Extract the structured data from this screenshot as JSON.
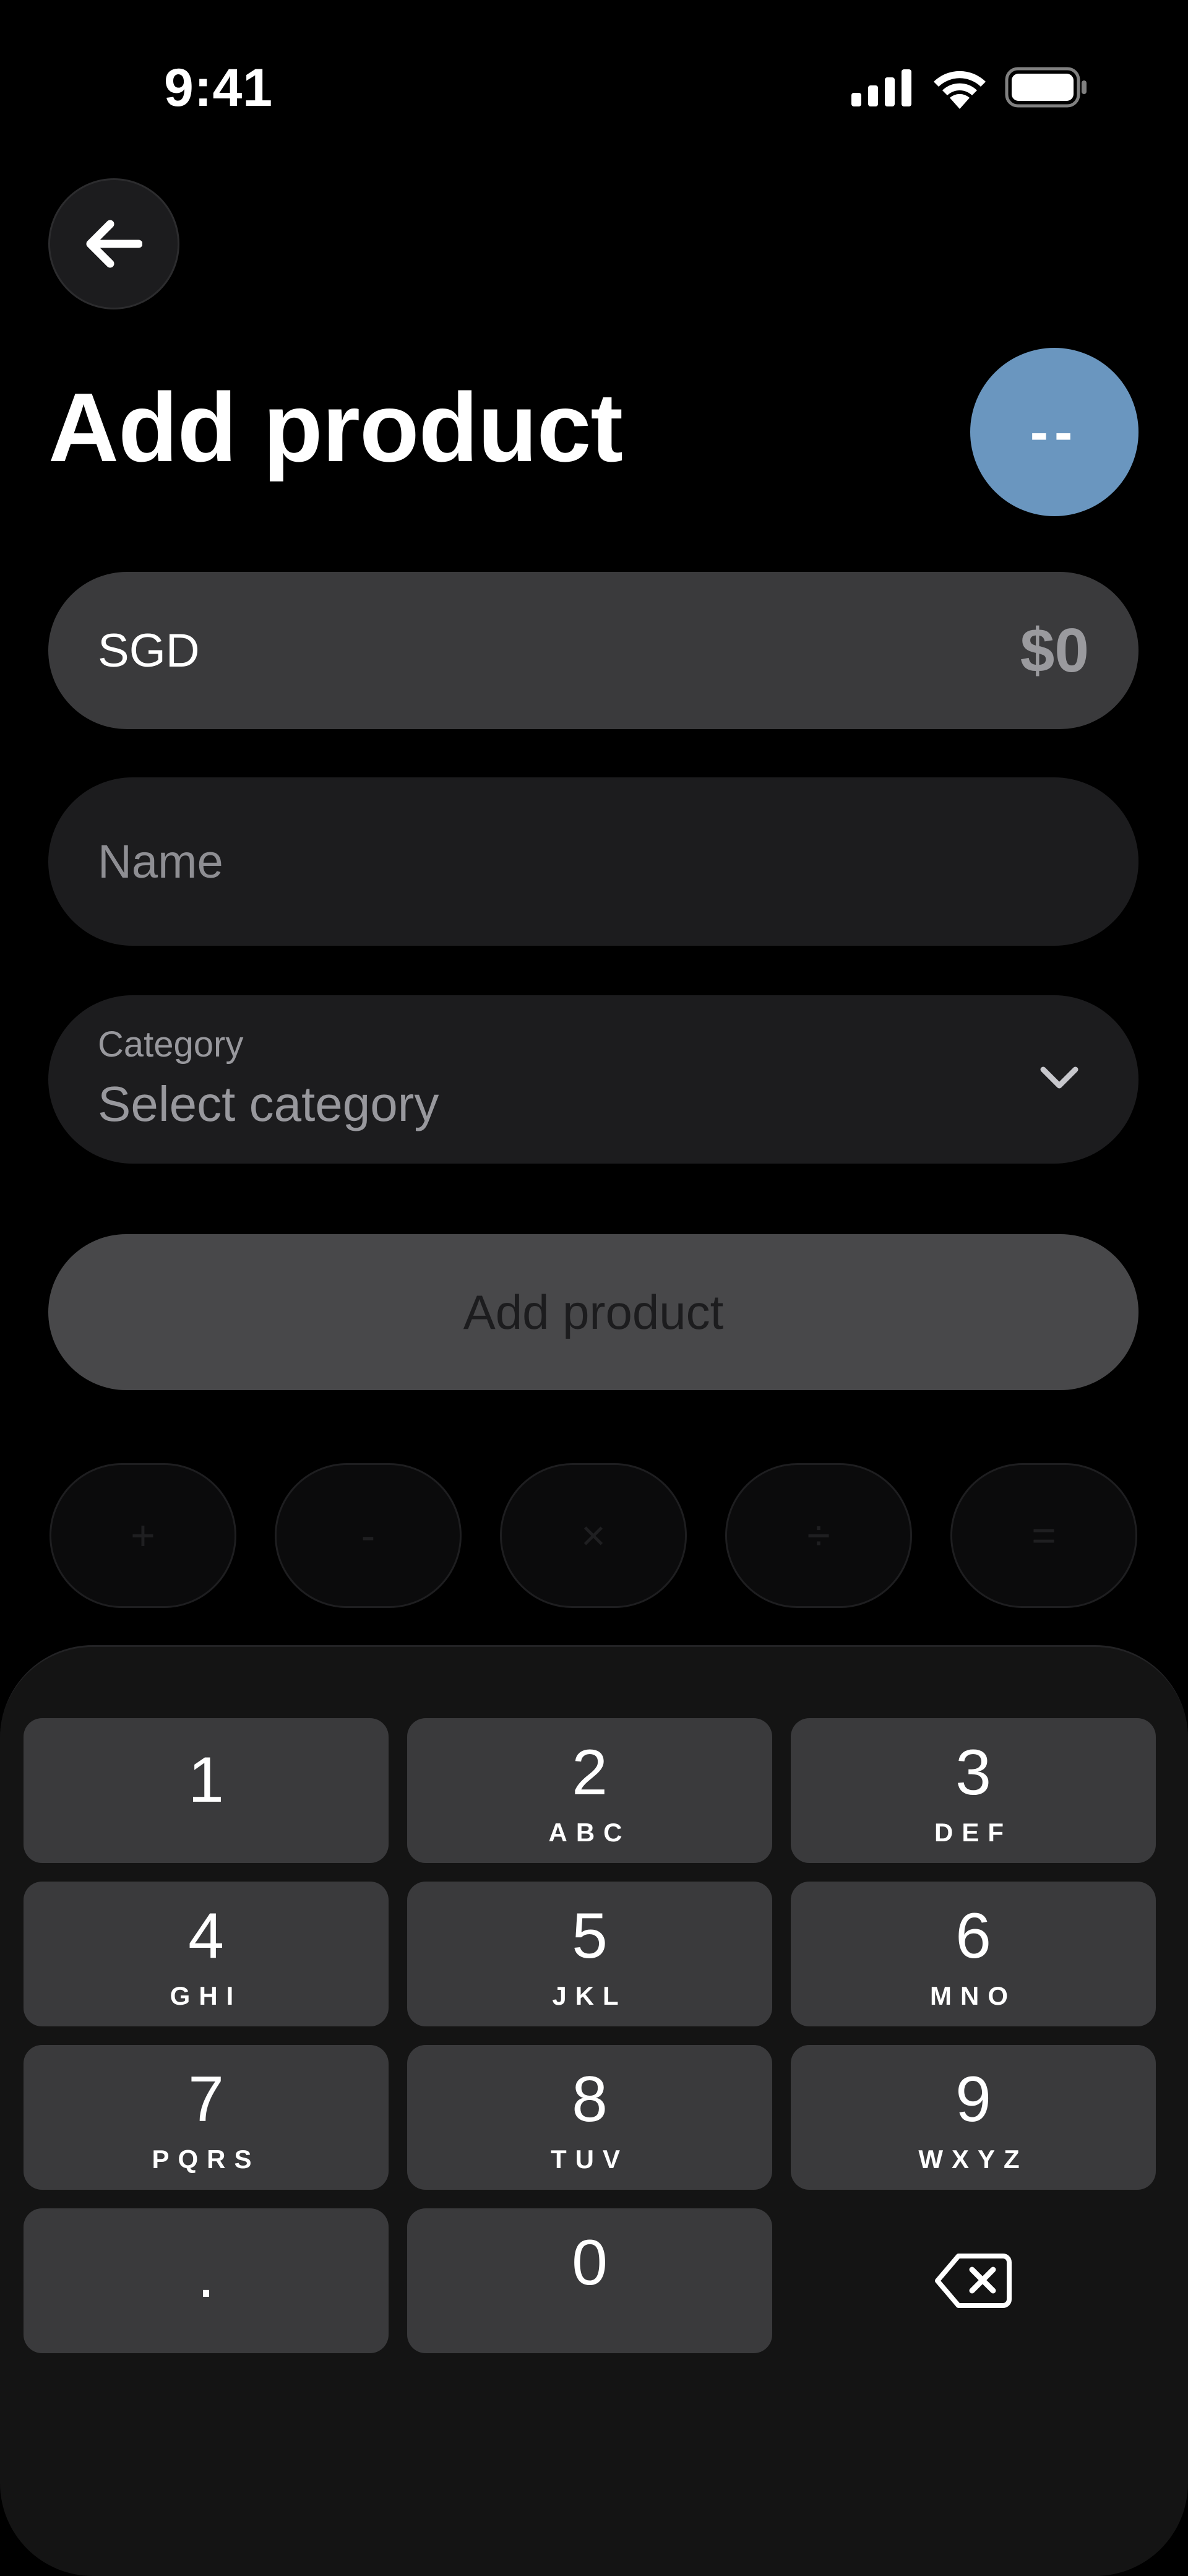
{
  "status_bar": {
    "time": "9:41"
  },
  "header": {
    "title": "Add product",
    "avatar_initials": "--",
    "avatar_color": "#6a96bf"
  },
  "form": {
    "amount": {
      "currency": "SGD",
      "value": "$0"
    },
    "name": {
      "placeholder": "Name"
    },
    "category": {
      "label": "Category",
      "placeholder": "Select category"
    },
    "submit_label": "Add product"
  },
  "operators": [
    "+",
    "-",
    "×",
    "÷",
    "="
  ],
  "keypad": {
    "keys": [
      {
        "digit": "1",
        "letters": ""
      },
      {
        "digit": "2",
        "letters": "ABC"
      },
      {
        "digit": "3",
        "letters": "DEF"
      },
      {
        "digit": "4",
        "letters": "GHI"
      },
      {
        "digit": "5",
        "letters": "JKL"
      },
      {
        "digit": "6",
        "letters": "MNO"
      },
      {
        "digit": "7",
        "letters": "PQRS"
      },
      {
        "digit": "8",
        "letters": "TUV"
      },
      {
        "digit": "9",
        "letters": "WXYZ"
      }
    ],
    "decimal": ".",
    "zero": "0",
    "delete_icon": "backspace-icon"
  }
}
